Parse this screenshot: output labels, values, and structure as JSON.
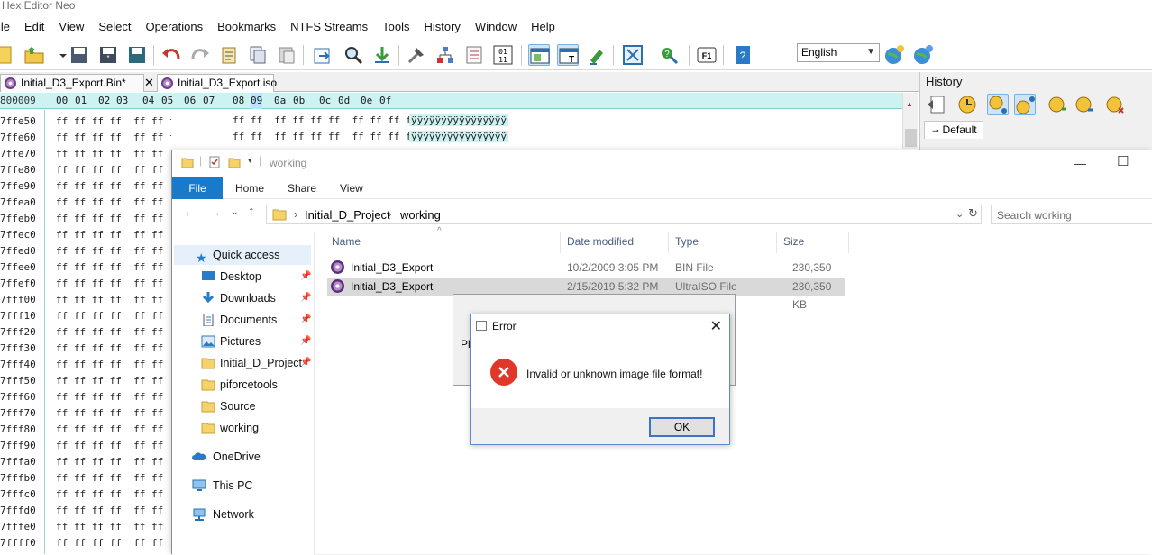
{
  "app": {
    "title": "Hex Editor Neo"
  },
  "menu": [
    "ile",
    "Edit",
    "View",
    "Select",
    "Operations",
    "Bookmarks",
    "NTFS Streams",
    "Tools",
    "History",
    "Window",
    "Help"
  ],
  "toolbar": {
    "language": "English"
  },
  "tabs": [
    {
      "label": "Initial_D3_Export.Bin*"
    },
    {
      "label": "Initial_D3_Export.iso"
    }
  ],
  "hex": {
    "header_addr": "800009",
    "columns": [
      "00",
      "01",
      "02",
      "03",
      "04",
      "05",
      "06",
      "07",
      "08",
      "09",
      "0a",
      "0b",
      "0c",
      "0d",
      "0e",
      "0f"
    ],
    "addresses": [
      "7ffe50",
      "7ffe60",
      "7ffe70",
      "7ffe80",
      "7ffe90",
      "7ffea0",
      "7ffeb0",
      "7ffec0",
      "7ffed0",
      "7ffee0",
      "7ffef0",
      "7fff00",
      "7fff10",
      "7fff20",
      "7fff30",
      "7fff40",
      "7fff50",
      "7fff60",
      "7fff70",
      "7fff80",
      "7fff90",
      "7fffa0",
      "7fffb0",
      "7fffc0",
      "7fffd0",
      "7fffe0",
      "7ffff0"
    ],
    "row_left": "ff ff ff ff  ff ff",
    "row_full": "ff ff ff ff  ff ff ff ff  ff ff ff ff  ff ff ff ff",
    "row_right": "ff ff  ff ff ff ff  ff ff ff ff  ff ff ff ff",
    "ascii": "ÿÿÿÿÿÿÿÿÿÿÿÿÿÿÿÿ"
  },
  "history": {
    "title": "History",
    "tab": "Default"
  },
  "explorer": {
    "title": "working",
    "ribbon": {
      "file": "File",
      "home": "Home",
      "share": "Share",
      "view": "View"
    },
    "breadcrumb": {
      "root": "Initial_D_Project",
      "current": "working"
    },
    "search_placeholder": "Search working",
    "nav": {
      "quick_access": "Quick access",
      "items": [
        "Desktop",
        "Downloads",
        "Documents",
        "Pictures",
        "Initial_D_Project",
        "piforcetools",
        "Source",
        "working"
      ],
      "onedrive": "OneDrive",
      "thispc": "This PC",
      "network": "Network"
    },
    "columns": {
      "name": "Name",
      "date": "Date modified",
      "type": "Type",
      "size": "Size"
    },
    "files": [
      {
        "name": "Initial_D3_Export",
        "date": "10/2/2009 3:05 PM",
        "type": "BIN File",
        "size": "230,350 KB"
      },
      {
        "name": "Initial_D3_Export",
        "date": "2/15/2019 5:32 PM",
        "type": "UltraISO File",
        "size": "230,350 KB"
      }
    ]
  },
  "bg_dialog": {
    "text": "Pl"
  },
  "error_dialog": {
    "title": "Error",
    "message": "Invalid or unknown image file format!",
    "ok": "OK"
  }
}
